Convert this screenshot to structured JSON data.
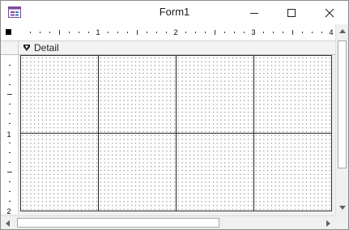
{
  "window": {
    "title": "Form1",
    "buttons": [
      "minimize",
      "maximize",
      "close"
    ]
  },
  "ruler": {
    "horizontal_numbers": [
      "1",
      "2",
      "3",
      "4"
    ],
    "vertical_numbers": [
      "1",
      "2"
    ]
  },
  "section": {
    "label": "Detail",
    "icon": "arrow-down-icon"
  },
  "grid": {
    "columns": 4,
    "rows": 2,
    "dot_pattern": true
  },
  "colors": {
    "title_bar": "#ffffff",
    "chrome": "#f0f0f0",
    "grid_lines": "#222222",
    "grid_dots": "#7a7a7a"
  }
}
